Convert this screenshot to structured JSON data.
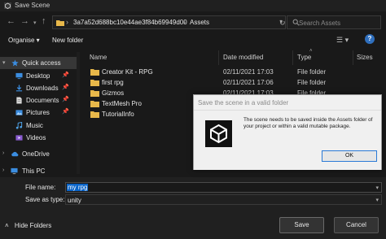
{
  "window": {
    "title": "Save Scene"
  },
  "address": {
    "segments": [
      "3a7a52d688bc10e44ae3f84b69949d00",
      "Assets"
    ],
    "search_placeholder": "Search Assets"
  },
  "toolbar": {
    "organise_label": "Organise ▾",
    "new_folder_label": "New folder",
    "help_label": "?"
  },
  "sidebar": {
    "items": [
      {
        "label": "Quick access",
        "icon": "star-icon",
        "pinned": false,
        "selected": true
      },
      {
        "label": "Desktop",
        "icon": "desktop-icon",
        "pinned": true
      },
      {
        "label": "Downloads",
        "icon": "download-icon",
        "pinned": true
      },
      {
        "label": "Documents",
        "icon": "documents-icon",
        "pinned": true
      },
      {
        "label": "Pictures",
        "icon": "pictures-icon",
        "pinned": true
      },
      {
        "label": "Music",
        "icon": "music-icon",
        "pinned": false
      },
      {
        "label": "Videos",
        "icon": "videos-icon",
        "pinned": false
      },
      {
        "label": "OneDrive",
        "icon": "cloud-icon",
        "pinned": false
      },
      {
        "label": "This PC",
        "icon": "computer-icon",
        "pinned": false
      }
    ]
  },
  "columns": {
    "name": "Name",
    "date": "Date modified",
    "type": "Type",
    "size": "Sizes"
  },
  "files": [
    {
      "name": "Creator Kit - RPG",
      "date": "02/11/2021 17:03",
      "type": "File folder"
    },
    {
      "name": "first rpg",
      "date": "02/11/2021 17:06",
      "type": "File folder"
    },
    {
      "name": "Gizmos",
      "date": "02/11/2021 17:03",
      "type": "File folder"
    },
    {
      "name": "TextMesh Pro",
      "date": "",
      "type": ""
    },
    {
      "name": "TutorialInfo",
      "date": "",
      "type": ""
    }
  ],
  "form": {
    "file_name_label": "File name:",
    "file_name_value": "my rpg",
    "save_as_type_label": "Save as type:",
    "save_as_type_value": "unity"
  },
  "footer": {
    "hide_folders_label": "Hide Folders",
    "save_label": "Save",
    "cancel_label": "Cancel"
  },
  "modal": {
    "title": "Save the scene in a valid folder",
    "message": "The scene needs to be saved inside the Assets folder of your project or within a valid mutable package.",
    "ok_label": "OK"
  },
  "colors": {
    "accent": "#0a64c8",
    "folder": "#e8b84a",
    "background": "#191919"
  }
}
